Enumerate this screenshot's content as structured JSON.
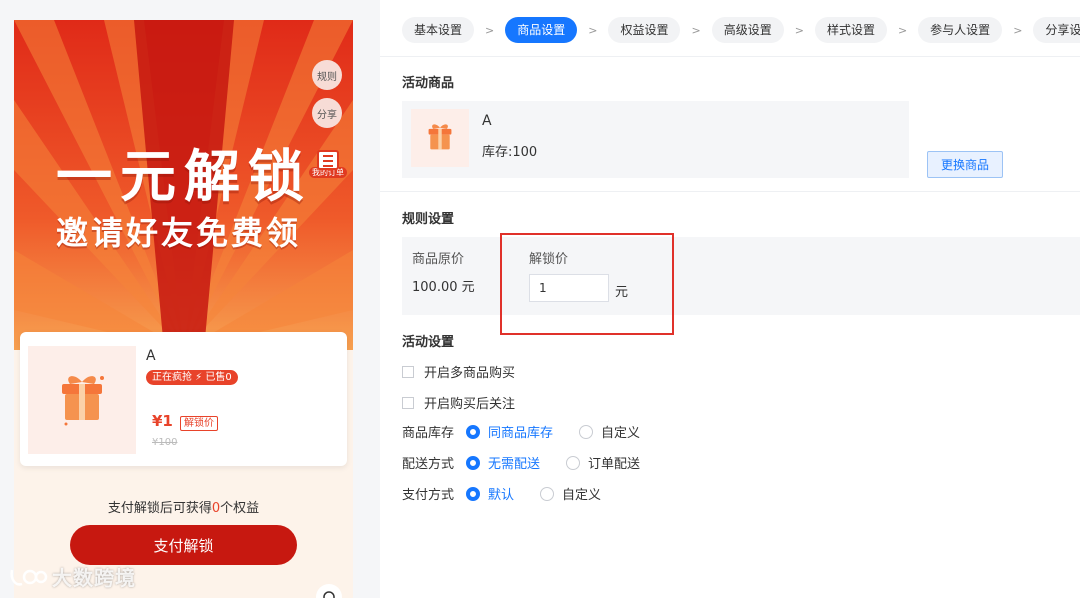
{
  "preview": {
    "headline": "一元解锁",
    "subheadline": "邀请好友免费领",
    "rule_btn": "规则",
    "share_btn": "分享",
    "my_orders": "我的订单",
    "product_name": "A",
    "hot_tag": "正在疯抢 ⚡  已售0",
    "price": "¥1",
    "price_tag": "解锁价",
    "old_price": "¥100",
    "benefit_prefix": "支付解锁后可获得",
    "benefit_count": "0",
    "benefit_suffix": "个权益",
    "pay_button": "支付解锁",
    "headset_icon": "headset-icon",
    "watermark": "大数跨境"
  },
  "steps": [
    {
      "label": "基本设置",
      "active": false
    },
    {
      "label": "商品设置",
      "active": true
    },
    {
      "label": "权益设置",
      "active": false
    },
    {
      "label": "高级设置",
      "active": false
    },
    {
      "label": "样式设置",
      "active": false
    },
    {
      "label": "参与人设置",
      "active": false
    },
    {
      "label": "分享设置",
      "active": false
    }
  ],
  "step_separator": ">",
  "activity_goods": {
    "title": "活动商品",
    "name": "A",
    "stock": "库存:100",
    "change_button": "更换商品"
  },
  "rules": {
    "title": "规则设置",
    "original_price_label": "商品原价",
    "original_price_value": "100.00 元",
    "unlock_price_label": "解锁价",
    "unlock_price_value": "1",
    "unlock_price_unit": "元"
  },
  "activity_settings": {
    "title": "活动设置",
    "multi_goods": "开启多商品购买",
    "follow_after_buy": "开启购买后关注",
    "stock": {
      "label": "商品库存",
      "options": [
        "同商品库存",
        "自定义"
      ],
      "selected": 0
    },
    "delivery": {
      "label": "配送方式",
      "options": [
        "无需配送",
        "订单配送"
      ],
      "selected": 0
    },
    "payment": {
      "label": "支付方式",
      "options": [
        "默认",
        "自定义"
      ],
      "selected": 0
    }
  },
  "colors": {
    "accent": "#1677ff",
    "poster_red": "#e8432a",
    "pay_button": "#c71810",
    "highlight_frame": "#e0312a"
  }
}
